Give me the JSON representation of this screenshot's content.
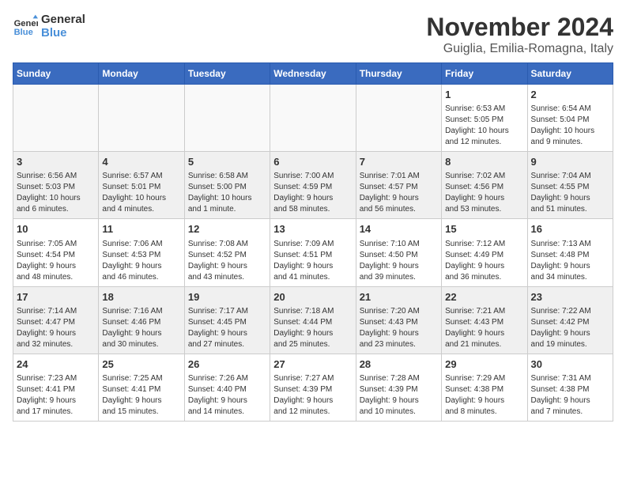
{
  "logo": {
    "line1": "General",
    "line2": "Blue"
  },
  "title": "November 2024",
  "subtitle": "Guiglia, Emilia-Romagna, Italy",
  "weekdays": [
    "Sunday",
    "Monday",
    "Tuesday",
    "Wednesday",
    "Thursday",
    "Friday",
    "Saturday"
  ],
  "weeks": [
    [
      {
        "day": "",
        "info": ""
      },
      {
        "day": "",
        "info": ""
      },
      {
        "day": "",
        "info": ""
      },
      {
        "day": "",
        "info": ""
      },
      {
        "day": "",
        "info": ""
      },
      {
        "day": "1",
        "info": "Sunrise: 6:53 AM\nSunset: 5:05 PM\nDaylight: 10 hours\nand 12 minutes."
      },
      {
        "day": "2",
        "info": "Sunrise: 6:54 AM\nSunset: 5:04 PM\nDaylight: 10 hours\nand 9 minutes."
      }
    ],
    [
      {
        "day": "3",
        "info": "Sunrise: 6:56 AM\nSunset: 5:03 PM\nDaylight: 10 hours\nand 6 minutes."
      },
      {
        "day": "4",
        "info": "Sunrise: 6:57 AM\nSunset: 5:01 PM\nDaylight: 10 hours\nand 4 minutes."
      },
      {
        "day": "5",
        "info": "Sunrise: 6:58 AM\nSunset: 5:00 PM\nDaylight: 10 hours\nand 1 minute."
      },
      {
        "day": "6",
        "info": "Sunrise: 7:00 AM\nSunset: 4:59 PM\nDaylight: 9 hours\nand 58 minutes."
      },
      {
        "day": "7",
        "info": "Sunrise: 7:01 AM\nSunset: 4:57 PM\nDaylight: 9 hours\nand 56 minutes."
      },
      {
        "day": "8",
        "info": "Sunrise: 7:02 AM\nSunset: 4:56 PM\nDaylight: 9 hours\nand 53 minutes."
      },
      {
        "day": "9",
        "info": "Sunrise: 7:04 AM\nSunset: 4:55 PM\nDaylight: 9 hours\nand 51 minutes."
      }
    ],
    [
      {
        "day": "10",
        "info": "Sunrise: 7:05 AM\nSunset: 4:54 PM\nDaylight: 9 hours\nand 48 minutes."
      },
      {
        "day": "11",
        "info": "Sunrise: 7:06 AM\nSunset: 4:53 PM\nDaylight: 9 hours\nand 46 minutes."
      },
      {
        "day": "12",
        "info": "Sunrise: 7:08 AM\nSunset: 4:52 PM\nDaylight: 9 hours\nand 43 minutes."
      },
      {
        "day": "13",
        "info": "Sunrise: 7:09 AM\nSunset: 4:51 PM\nDaylight: 9 hours\nand 41 minutes."
      },
      {
        "day": "14",
        "info": "Sunrise: 7:10 AM\nSunset: 4:50 PM\nDaylight: 9 hours\nand 39 minutes."
      },
      {
        "day": "15",
        "info": "Sunrise: 7:12 AM\nSunset: 4:49 PM\nDaylight: 9 hours\nand 36 minutes."
      },
      {
        "day": "16",
        "info": "Sunrise: 7:13 AM\nSunset: 4:48 PM\nDaylight: 9 hours\nand 34 minutes."
      }
    ],
    [
      {
        "day": "17",
        "info": "Sunrise: 7:14 AM\nSunset: 4:47 PM\nDaylight: 9 hours\nand 32 minutes."
      },
      {
        "day": "18",
        "info": "Sunrise: 7:16 AM\nSunset: 4:46 PM\nDaylight: 9 hours\nand 30 minutes."
      },
      {
        "day": "19",
        "info": "Sunrise: 7:17 AM\nSunset: 4:45 PM\nDaylight: 9 hours\nand 27 minutes."
      },
      {
        "day": "20",
        "info": "Sunrise: 7:18 AM\nSunset: 4:44 PM\nDaylight: 9 hours\nand 25 minutes."
      },
      {
        "day": "21",
        "info": "Sunrise: 7:20 AM\nSunset: 4:43 PM\nDaylight: 9 hours\nand 23 minutes."
      },
      {
        "day": "22",
        "info": "Sunrise: 7:21 AM\nSunset: 4:43 PM\nDaylight: 9 hours\nand 21 minutes."
      },
      {
        "day": "23",
        "info": "Sunrise: 7:22 AM\nSunset: 4:42 PM\nDaylight: 9 hours\nand 19 minutes."
      }
    ],
    [
      {
        "day": "24",
        "info": "Sunrise: 7:23 AM\nSunset: 4:41 PM\nDaylight: 9 hours\nand 17 minutes."
      },
      {
        "day": "25",
        "info": "Sunrise: 7:25 AM\nSunset: 4:41 PM\nDaylight: 9 hours\nand 15 minutes."
      },
      {
        "day": "26",
        "info": "Sunrise: 7:26 AM\nSunset: 4:40 PM\nDaylight: 9 hours\nand 14 minutes."
      },
      {
        "day": "27",
        "info": "Sunrise: 7:27 AM\nSunset: 4:39 PM\nDaylight: 9 hours\nand 12 minutes."
      },
      {
        "day": "28",
        "info": "Sunrise: 7:28 AM\nSunset: 4:39 PM\nDaylight: 9 hours\nand 10 minutes."
      },
      {
        "day": "29",
        "info": "Sunrise: 7:29 AM\nSunset: 4:38 PM\nDaylight: 9 hours\nand 8 minutes."
      },
      {
        "day": "30",
        "info": "Sunrise: 7:31 AM\nSunset: 4:38 PM\nDaylight: 9 hours\nand 7 minutes."
      }
    ]
  ]
}
